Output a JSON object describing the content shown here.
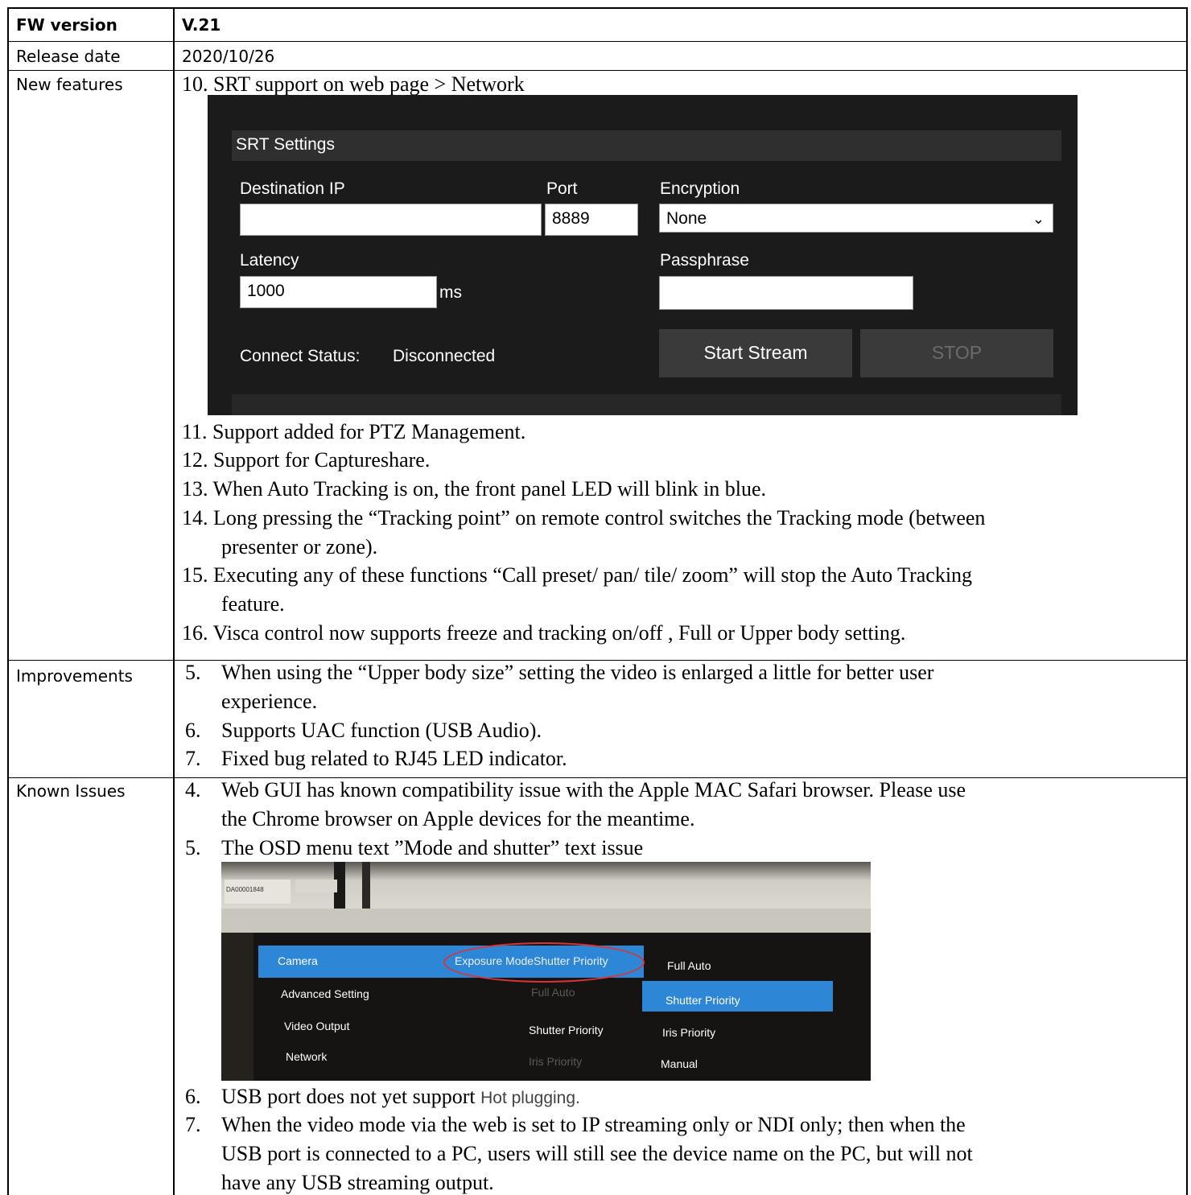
{
  "table": {
    "fw_label": "FW version",
    "fw_value": "V.21",
    "date_label": "Release date",
    "date_value": "2020/10/26",
    "new_label": "New features",
    "improve_label": "Improvements",
    "known_label": "Known Issues"
  },
  "new_features": {
    "item10": "10. SRT support on web page > Network",
    "item11": "11. Support added for PTZ Management.",
    "item12": "12. Support for Captureshare.",
    "item13": "13. When Auto Tracking is on, the front panel LED will blink in blue.",
    "item14_a": "14. Long pressing the “Tracking point” on remote control switches the Tracking mode (between",
    "item14_b": "presenter or zone).",
    "item15_a": "15. Executing any of these functions “Call preset/ pan/ tile/ zoom” will stop the Auto Tracking",
    "item15_b": "feature.",
    "item16": "16. Visca control now supports freeze and tracking on/off , Full or Upper body setting."
  },
  "srt": {
    "title": "SRT Settings",
    "dest_label": "Destination IP",
    "dest_value": "",
    "port_label": "Port",
    "port_value": "8889",
    "enc_label": "Encryption",
    "enc_value": "None",
    "latency_label": "Latency",
    "latency_value": "1000",
    "latency_unit": "ms",
    "pass_label": "Passphrase",
    "pass_value": "",
    "status_label": "Connect Status:",
    "status_value": "Disconnected",
    "start_label": "Start Stream",
    "stop_label": "STOP"
  },
  "improvements": {
    "item5_num": "5.",
    "item5_a": "When using the “Upper body size” setting the video is enlarged a little for better user",
    "item5_b": "experience.",
    "item6_num": "6.",
    "item6": "Supports UAC function (USB Audio).",
    "item7_num": "7.",
    "item7": "Fixed bug related to RJ45 LED indicator."
  },
  "known": {
    "item4_num": "4.",
    "item4_a": "Web GUI has known compatibility issue with the Apple MAC Safari browser.  Please use",
    "item4_b": "the Chrome browser on Apple devices for the meantime.",
    "item5_num": "5.",
    "item5": "The OSD menu text ”Mode and shutter” text issue",
    "item6_num": "6.",
    "item6_a": "USB port does not yet support",
    "item6_b": "Hot plugging.",
    "item7_num": "7.",
    "item7_a": "When the video mode via the web is set to IP streaming only or NDI only; then when the",
    "item7_b": "USB port is connected to a PC, users will still see the device name on the PC, but will not",
    "item7_c": "have any USB streaming output."
  },
  "osd": {
    "sticker_a": "DA00001848",
    "menu_camera": "Camera",
    "menu_advanced": "Advanced Setting",
    "menu_video": "Video Output",
    "menu_network": "Network",
    "col2_header": "Exposure ModeShutter Priority",
    "col2_full": "Full Auto",
    "col2_shutter": "Shutter Priority",
    "col2_iris": "Iris Priority",
    "col3_full": "Full Auto",
    "col3_shutter": "Shutter Priority",
    "col3_iris": "Iris Priority",
    "col3_manual": "Manual"
  }
}
